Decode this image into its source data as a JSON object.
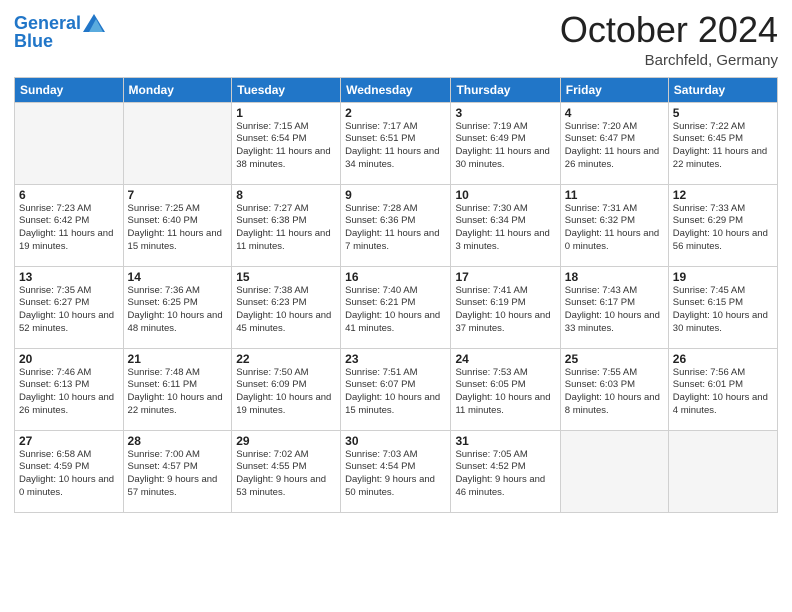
{
  "logo": {
    "line1": "General",
    "line2": "Blue"
  },
  "header": {
    "month": "October 2024",
    "location": "Barchfeld, Germany"
  },
  "weekdays": [
    "Sunday",
    "Monday",
    "Tuesday",
    "Wednesday",
    "Thursday",
    "Friday",
    "Saturday"
  ],
  "weeks": [
    [
      {
        "day": "",
        "info": ""
      },
      {
        "day": "",
        "info": ""
      },
      {
        "day": "1",
        "info": "Sunrise: 7:15 AM\nSunset: 6:54 PM\nDaylight: 11 hours and 38 minutes."
      },
      {
        "day": "2",
        "info": "Sunrise: 7:17 AM\nSunset: 6:51 PM\nDaylight: 11 hours and 34 minutes."
      },
      {
        "day": "3",
        "info": "Sunrise: 7:19 AM\nSunset: 6:49 PM\nDaylight: 11 hours and 30 minutes."
      },
      {
        "day": "4",
        "info": "Sunrise: 7:20 AM\nSunset: 6:47 PM\nDaylight: 11 hours and 26 minutes."
      },
      {
        "day": "5",
        "info": "Sunrise: 7:22 AM\nSunset: 6:45 PM\nDaylight: 11 hours and 22 minutes."
      }
    ],
    [
      {
        "day": "6",
        "info": "Sunrise: 7:23 AM\nSunset: 6:42 PM\nDaylight: 11 hours and 19 minutes."
      },
      {
        "day": "7",
        "info": "Sunrise: 7:25 AM\nSunset: 6:40 PM\nDaylight: 11 hours and 15 minutes."
      },
      {
        "day": "8",
        "info": "Sunrise: 7:27 AM\nSunset: 6:38 PM\nDaylight: 11 hours and 11 minutes."
      },
      {
        "day": "9",
        "info": "Sunrise: 7:28 AM\nSunset: 6:36 PM\nDaylight: 11 hours and 7 minutes."
      },
      {
        "day": "10",
        "info": "Sunrise: 7:30 AM\nSunset: 6:34 PM\nDaylight: 11 hours and 3 minutes."
      },
      {
        "day": "11",
        "info": "Sunrise: 7:31 AM\nSunset: 6:32 PM\nDaylight: 11 hours and 0 minutes."
      },
      {
        "day": "12",
        "info": "Sunrise: 7:33 AM\nSunset: 6:29 PM\nDaylight: 10 hours and 56 minutes."
      }
    ],
    [
      {
        "day": "13",
        "info": "Sunrise: 7:35 AM\nSunset: 6:27 PM\nDaylight: 10 hours and 52 minutes."
      },
      {
        "day": "14",
        "info": "Sunrise: 7:36 AM\nSunset: 6:25 PM\nDaylight: 10 hours and 48 minutes."
      },
      {
        "day": "15",
        "info": "Sunrise: 7:38 AM\nSunset: 6:23 PM\nDaylight: 10 hours and 45 minutes."
      },
      {
        "day": "16",
        "info": "Sunrise: 7:40 AM\nSunset: 6:21 PM\nDaylight: 10 hours and 41 minutes."
      },
      {
        "day": "17",
        "info": "Sunrise: 7:41 AM\nSunset: 6:19 PM\nDaylight: 10 hours and 37 minutes."
      },
      {
        "day": "18",
        "info": "Sunrise: 7:43 AM\nSunset: 6:17 PM\nDaylight: 10 hours and 33 minutes."
      },
      {
        "day": "19",
        "info": "Sunrise: 7:45 AM\nSunset: 6:15 PM\nDaylight: 10 hours and 30 minutes."
      }
    ],
    [
      {
        "day": "20",
        "info": "Sunrise: 7:46 AM\nSunset: 6:13 PM\nDaylight: 10 hours and 26 minutes."
      },
      {
        "day": "21",
        "info": "Sunrise: 7:48 AM\nSunset: 6:11 PM\nDaylight: 10 hours and 22 minutes."
      },
      {
        "day": "22",
        "info": "Sunrise: 7:50 AM\nSunset: 6:09 PM\nDaylight: 10 hours and 19 minutes."
      },
      {
        "day": "23",
        "info": "Sunrise: 7:51 AM\nSunset: 6:07 PM\nDaylight: 10 hours and 15 minutes."
      },
      {
        "day": "24",
        "info": "Sunrise: 7:53 AM\nSunset: 6:05 PM\nDaylight: 10 hours and 11 minutes."
      },
      {
        "day": "25",
        "info": "Sunrise: 7:55 AM\nSunset: 6:03 PM\nDaylight: 10 hours and 8 minutes."
      },
      {
        "day": "26",
        "info": "Sunrise: 7:56 AM\nSunset: 6:01 PM\nDaylight: 10 hours and 4 minutes."
      }
    ],
    [
      {
        "day": "27",
        "info": "Sunrise: 6:58 AM\nSunset: 4:59 PM\nDaylight: 10 hours and 0 minutes."
      },
      {
        "day": "28",
        "info": "Sunrise: 7:00 AM\nSunset: 4:57 PM\nDaylight: 9 hours and 57 minutes."
      },
      {
        "day": "29",
        "info": "Sunrise: 7:02 AM\nSunset: 4:55 PM\nDaylight: 9 hours and 53 minutes."
      },
      {
        "day": "30",
        "info": "Sunrise: 7:03 AM\nSunset: 4:54 PM\nDaylight: 9 hours and 50 minutes."
      },
      {
        "day": "31",
        "info": "Sunrise: 7:05 AM\nSunset: 4:52 PM\nDaylight: 9 hours and 46 minutes."
      },
      {
        "day": "",
        "info": ""
      },
      {
        "day": "",
        "info": ""
      }
    ]
  ]
}
